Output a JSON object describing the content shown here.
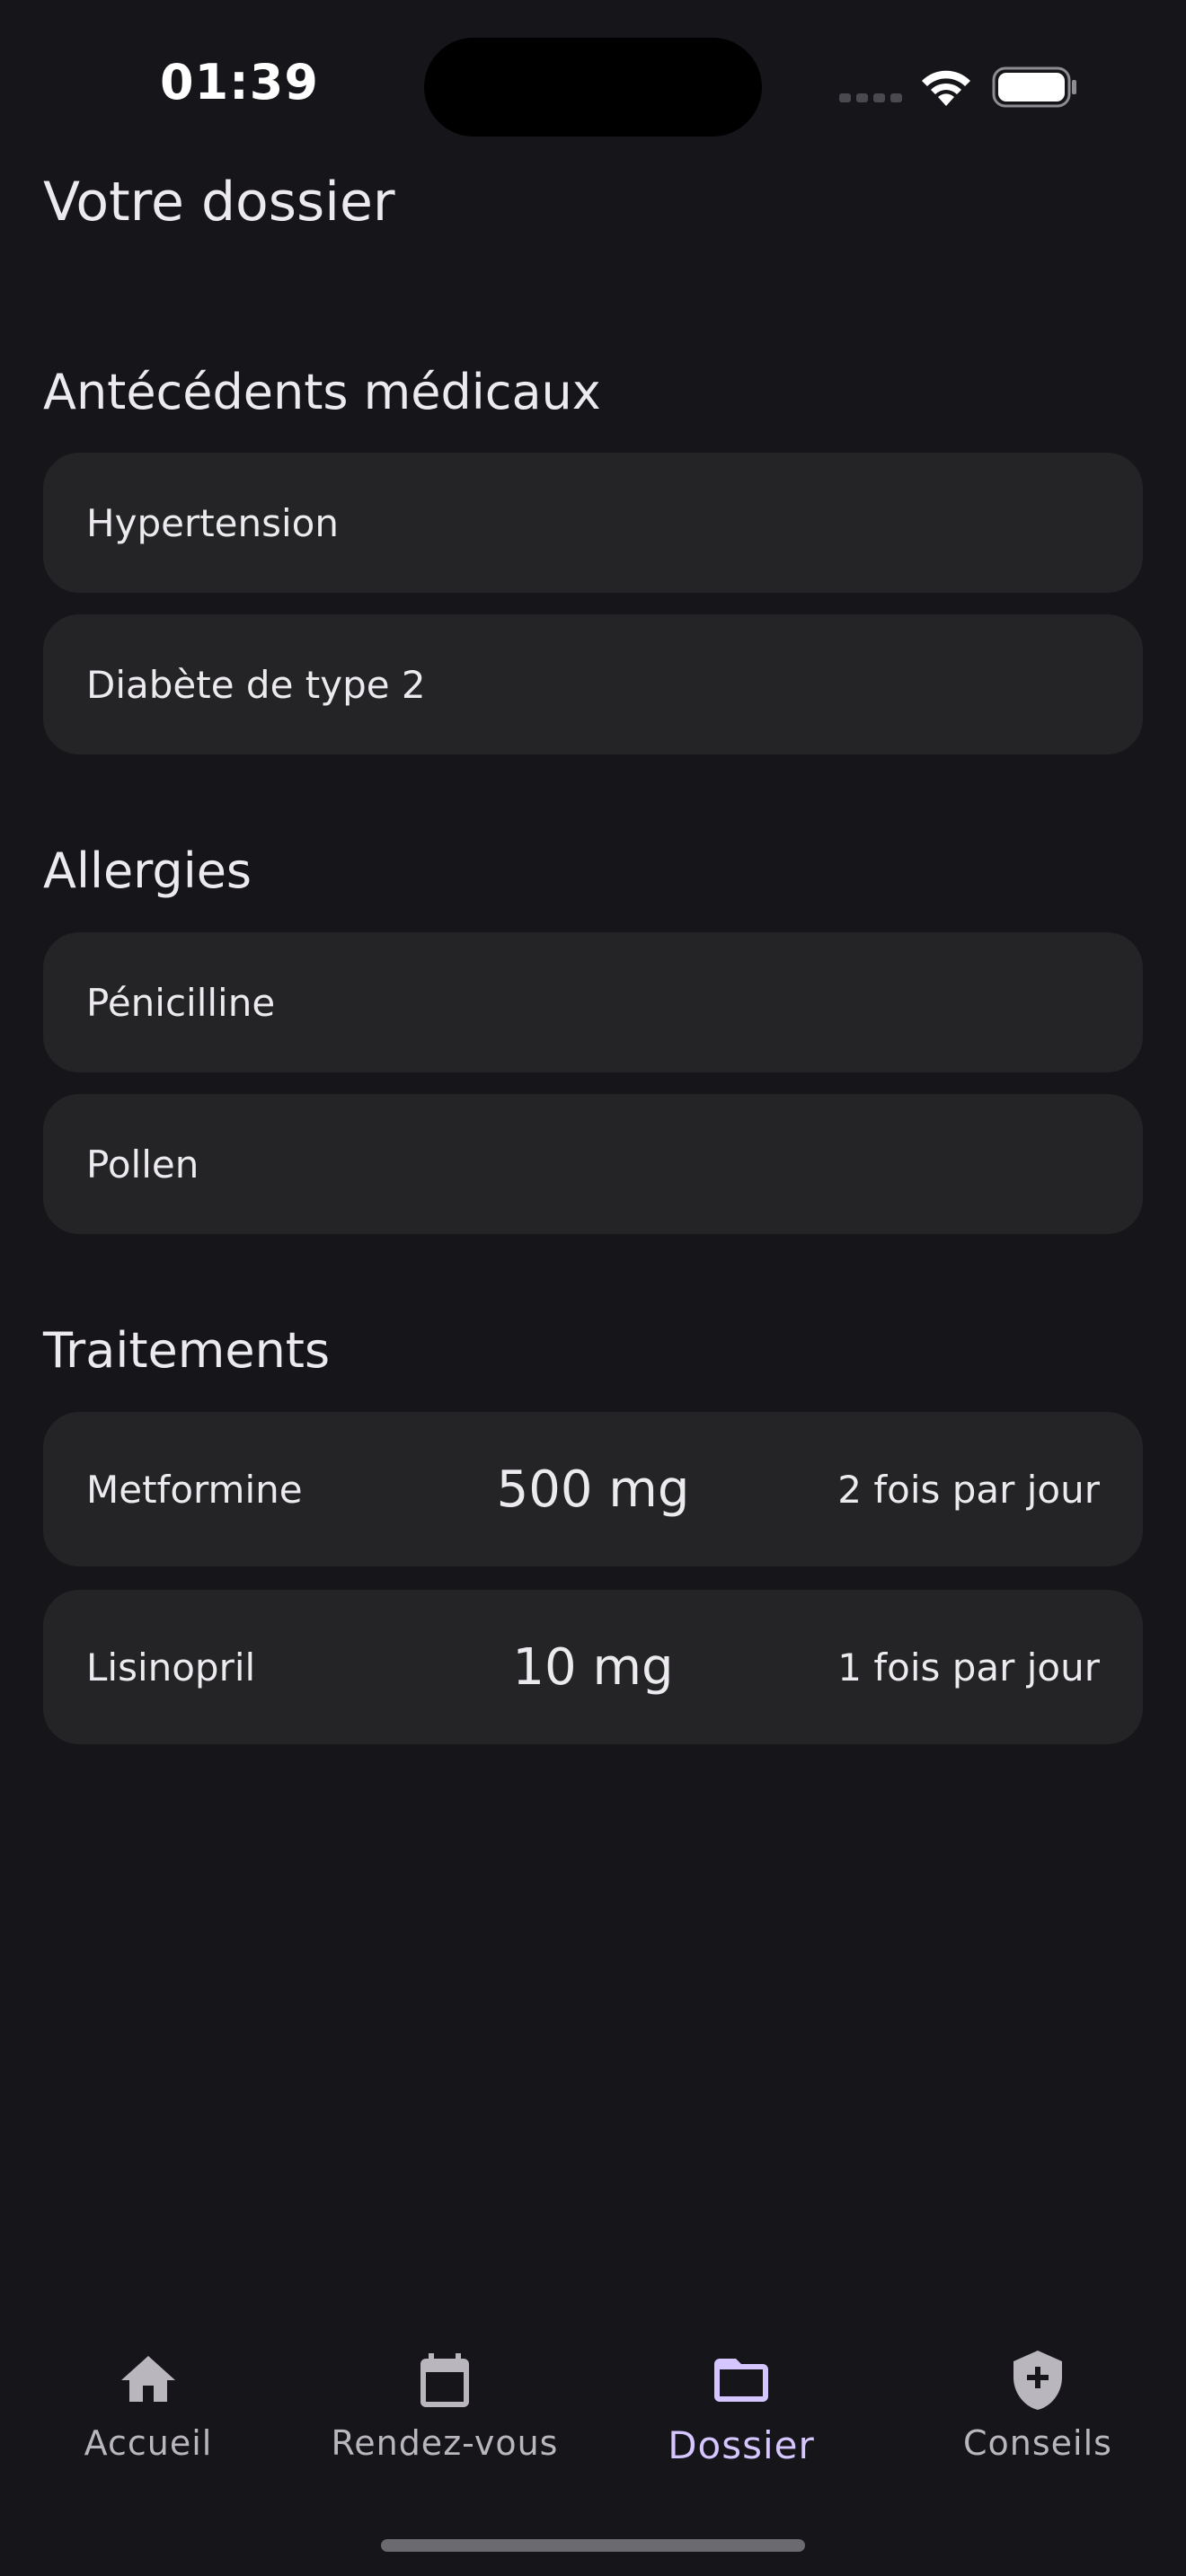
{
  "status": {
    "time": "01:39"
  },
  "page": {
    "title": "Votre dossier"
  },
  "sections": {
    "history": {
      "title": "Antécédents médicaux",
      "items": [
        "Hypertension",
        "Diabète de type 2"
      ]
    },
    "allergies": {
      "title": "Allergies",
      "items": [
        "Pénicilline",
        "Pollen"
      ]
    },
    "treatments": {
      "title": "Traitements",
      "items": [
        {
          "name": "Metformine",
          "dose": "500 mg",
          "frequency": "2 fois par jour"
        },
        {
          "name": "Lisinopril",
          "dose": "10 mg",
          "frequency": "1 fois par jour"
        }
      ]
    }
  },
  "nav": {
    "items": [
      {
        "label": "Accueil",
        "icon": "home-icon",
        "active": false
      },
      {
        "label": "Rendez-vous",
        "icon": "calendar-icon",
        "active": false
      },
      {
        "label": "Dossier",
        "icon": "folder-icon",
        "active": true
      },
      {
        "label": "Conseils",
        "icon": "shield-plus-icon",
        "active": false
      }
    ]
  },
  "colors": {
    "background": "#16151a",
    "card": "#242426",
    "text": "#ece9ef",
    "nav_inactive": "#b9b6bd",
    "nav_active": "#d6c6ff"
  }
}
